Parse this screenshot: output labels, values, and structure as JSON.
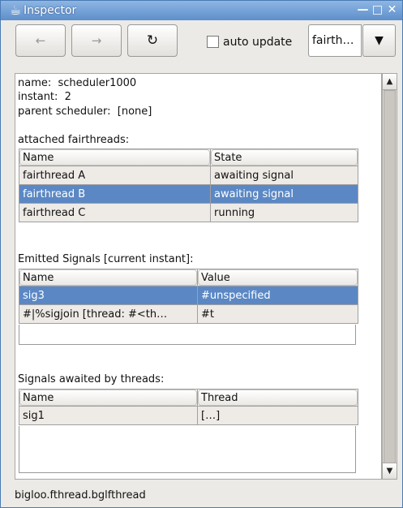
{
  "window": {
    "title": "Inspector"
  },
  "toolbar": {
    "back_icon": "←",
    "forward_icon": "→",
    "refresh_icon": "↻",
    "auto_update_label": "auto update",
    "combo_value": "fairth…",
    "dropdown_icon": "▼"
  },
  "info": {
    "name_label": "name:",
    "name_value": "scheduler1000",
    "instant_label": "instant:",
    "instant_value": "2",
    "parent_label": "parent scheduler:",
    "parent_value": "[none]"
  },
  "fairthreads": {
    "title": "attached fairthreads:",
    "columns": [
      "Name",
      "State"
    ],
    "rows": [
      {
        "name": "fairthread A",
        "state": "awaiting signal"
      },
      {
        "name": "fairthread B",
        "state": "awaiting signal"
      },
      {
        "name": "fairthread C",
        "state": "running"
      }
    ]
  },
  "emitted": {
    "title": "Emitted Signals [current instant]:",
    "columns": [
      "Name",
      "Value"
    ],
    "rows": [
      {
        "name": "sig3",
        "value": "#unspecified"
      },
      {
        "name": "#|%sigjoin [thread: #<th…",
        "value": "#t"
      }
    ]
  },
  "awaited": {
    "title": "Signals awaited by threads:",
    "columns": [
      "Name",
      "Thread"
    ],
    "rows": [
      {
        "name": "sig1",
        "thread": "[…]"
      }
    ]
  },
  "status": {
    "text": "bigloo.fthread.bglfthread"
  },
  "colors": {
    "selection": "#5b88c4",
    "titlebar": "#6a99d2"
  }
}
